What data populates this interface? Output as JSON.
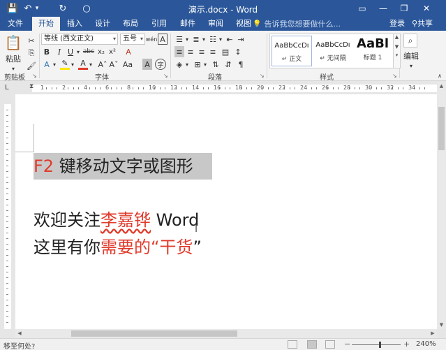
{
  "app": {
    "title": "演示.docx - Word",
    "qat": {
      "save": "💾",
      "undo": "↶",
      "undo_dd": "▾",
      "redo": "↻",
      "circle": "○"
    },
    "window_buttons": {
      "ribbon_options": "▭",
      "minimize": "—",
      "restore": "❐",
      "close": "✕"
    }
  },
  "tabs": [
    {
      "label": "文件"
    },
    {
      "label": "开始"
    },
    {
      "label": "插入"
    },
    {
      "label": "设计"
    },
    {
      "label": "布局"
    },
    {
      "label": "引用"
    },
    {
      "label": "邮件"
    },
    {
      "label": "审阅"
    },
    {
      "label": "视图"
    }
  ],
  "tell_me": {
    "placeholder": "告诉我您想要做什么..."
  },
  "account": {
    "login": "登录",
    "share": "共享"
  },
  "ribbon": {
    "clipboard": {
      "paste": "粘贴",
      "label": "剪贴板"
    },
    "font": {
      "family": "等线 (西文正文)",
      "size": "五号",
      "label": "字体",
      "wen": "wén",
      "A_box": "A",
      "bold": "B",
      "italic": "I",
      "underline": "U",
      "strike": "abc",
      "sub": "x₂",
      "sup": "x²",
      "grow": "Aˆ",
      "shrink": "Aˇ",
      "case": "Aa",
      "clear": "A",
      "effects": "A",
      "font_color": "A",
      "char_shade": "A",
      "enclose": "字"
    },
    "paragraph": {
      "label": "段落"
    },
    "styles": {
      "label": "样式",
      "items": [
        {
          "sample": "AaBbCcDı",
          "name": "↵ 正文"
        },
        {
          "sample": "AaBbCcDı",
          "name": "↵ 无间隔"
        },
        {
          "sample": "AaBl",
          "name": "标题 1"
        }
      ]
    },
    "editing": {
      "label": "编辑"
    }
  },
  "ruler": {
    "marks": [
      "1",
      "2",
      "4",
      "6",
      "8",
      "10",
      "12",
      "14",
      "16",
      "18",
      "20",
      "22",
      "24",
      "26",
      "28",
      "30",
      "32",
      "34"
    ]
  },
  "document": {
    "line1": {
      "prefix": "F2",
      "rest": " 键移动文字或图形"
    },
    "line2": {
      "a": "欢迎关注",
      "b": "李嘉铧",
      "c": " Word"
    },
    "line3": {
      "a": "这里有你",
      "b": "需要的“干货",
      "c": "”"
    }
  },
  "status": {
    "text": "移至何处?",
    "zoom": "240%",
    "zoom_level": 0.55,
    "minus": "−",
    "plus": "+"
  },
  "colors": {
    "brand": "#2b579a",
    "accent_red": "#e03a2b",
    "highlight": "#c8c8c8"
  }
}
